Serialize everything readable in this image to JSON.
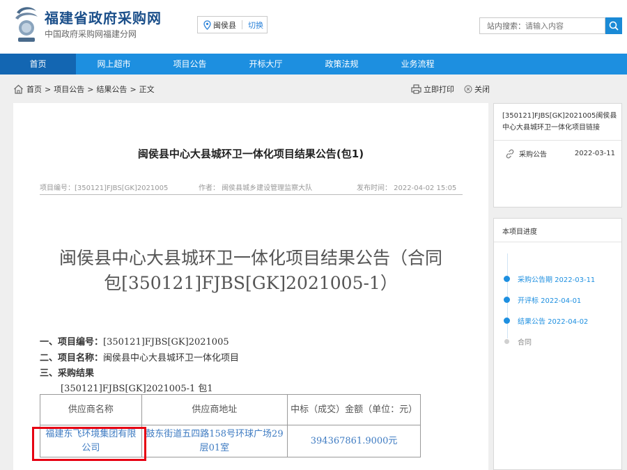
{
  "header": {
    "site_title": "福建省政府采购网",
    "site_subtitle": "中国政府采购网福建分网",
    "region_name": "闽侯县",
    "region_switch": "切换",
    "search_label": "站内搜索：",
    "search_placeholder": "请输入内容"
  },
  "nav": {
    "items": [
      "首页",
      "网上超市",
      "项目公告",
      "开标大厅",
      "政策法规",
      "业务流程"
    ]
  },
  "breadcrumb": {
    "home": "首页",
    "items": [
      "项目公告",
      "结果公告",
      "正文"
    ],
    "sep": ">"
  },
  "toolbar": {
    "print_label": "立即打印",
    "close_label": "关闭"
  },
  "article": {
    "short_title": "闽侯县中心大县城环卫一体化项目结果公告(包1)",
    "meta_project_no": "项目编号：[350121]FJBS[GK]2021005",
    "meta_author": "作者：  闽侯县城乡建设管理监察大队",
    "meta_publish_time": "发布时间：  2022-04-02 15:05",
    "big_title_line1": "闽侯县中心大县城环卫一体化项目结果公告（合同",
    "big_title_line2": "包[350121]FJBS[GK]2021005-1）",
    "info": {
      "item1_label": "一、项目编号：",
      "item1_value": "[350121]FJBS[GK]2021005",
      "item2_label": "二、项目名称：",
      "item2_value": "闽侯县中心大县城环卫一体化项目",
      "item3_label": "三、采购结果",
      "package_line": "[350121]FJBS[GK]2021005-1 包1"
    },
    "table": {
      "headers": [
        "供应商名称",
        "供应商地址",
        "中标（成交）金额（单位：元）"
      ],
      "rows": [
        [
          "福建东飞环境集团有限公司",
          "鼓东街道五四路158号环球广场29层01室",
          "394367861.9000元"
        ]
      ]
    }
  },
  "side_link": {
    "title": "[350121]FJBS[GK]2021005闽侯县中心大县城环卫一体化项目链接",
    "row_label": "采购公告",
    "row_date": "2022-03-11"
  },
  "progress": {
    "title": "本项目进度",
    "items": [
      {
        "label": "采购公告期 2022-03-11",
        "done": true
      },
      {
        "label": "开评标 2022-04-01",
        "done": true
      },
      {
        "label": "结果公告 2022-04-02",
        "done": true
      },
      {
        "label": "合同",
        "done": false
      }
    ]
  },
  "colors": {
    "nav_bg": "#1d8fe0",
    "nav_active": "#1366b2",
    "link_blue": "#3e7bc2",
    "highlight_red": "#e60012"
  }
}
